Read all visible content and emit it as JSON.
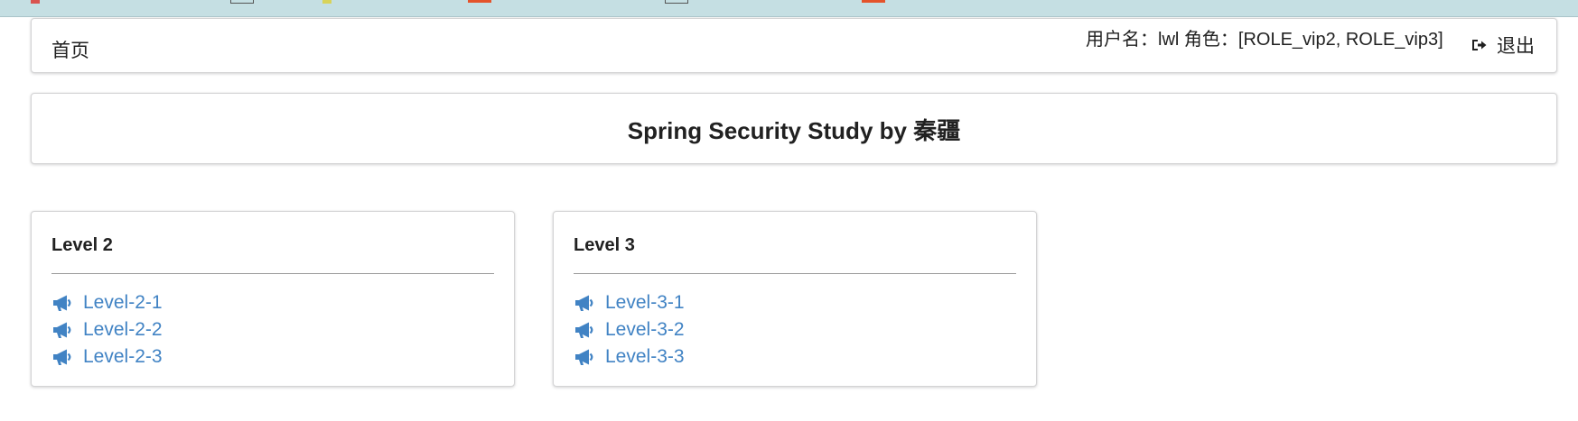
{
  "nav": {
    "home_label": "首页",
    "user_info": "用户名：lwl 角色：[ROLE_vip2, ROLE_vip3]",
    "logout_label": "退出",
    "logout_icon": "sign-out-icon"
  },
  "banner": {
    "title": "Spring Security Study by 秦疆"
  },
  "levels": [
    {
      "title": "Level 2",
      "links": [
        "Level-2-1",
        "Level-2-2",
        "Level-2-3"
      ]
    },
    {
      "title": "Level 3",
      "links": [
        "Level-3-1",
        "Level-3-2",
        "Level-3-3"
      ]
    }
  ],
  "colors": {
    "link": "#4183c4",
    "text": "#212121",
    "browser_bar": "#c5dfe3"
  },
  "icons": {
    "link_icon": "bullhorn-icon"
  }
}
